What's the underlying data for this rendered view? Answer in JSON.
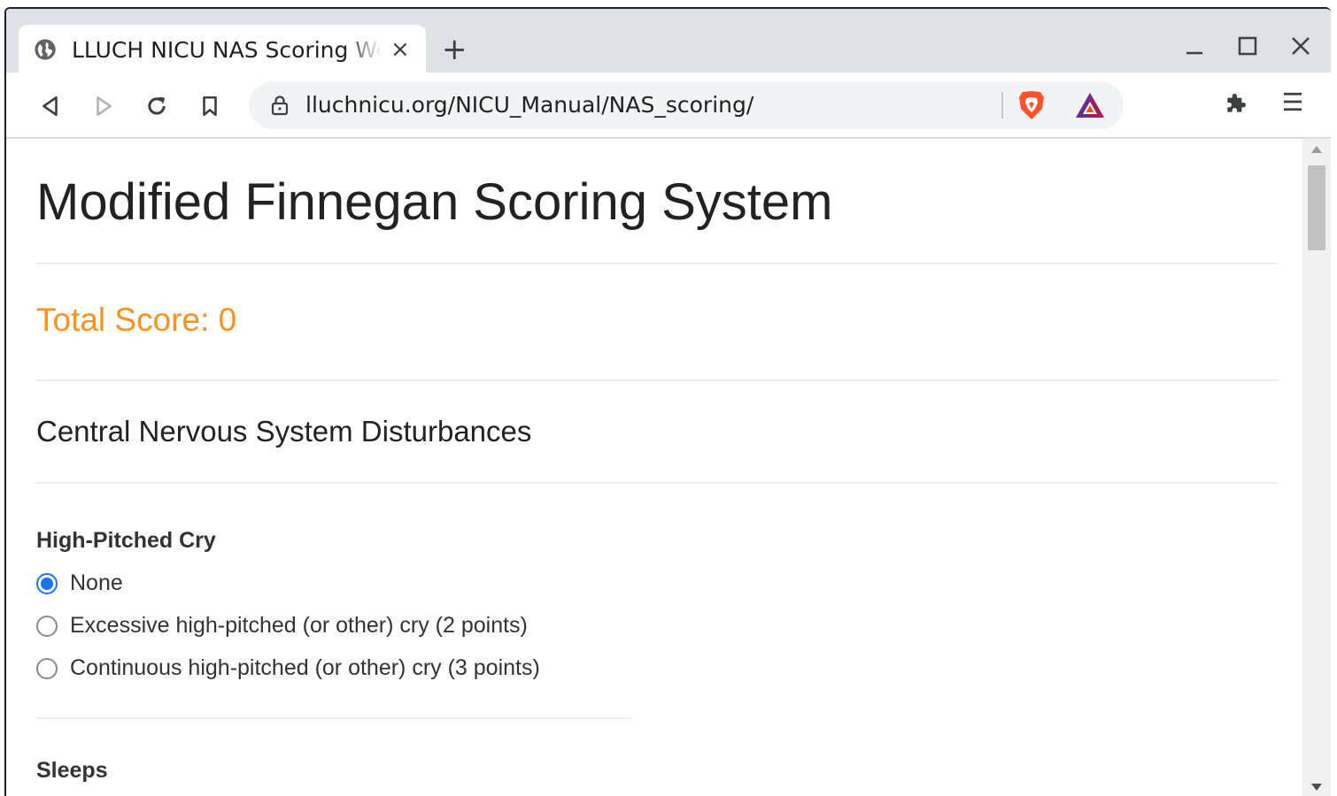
{
  "browser": {
    "tab_title": "LLUCH NICU NAS Scoring Web",
    "tab_close": "×",
    "new_tab": "+",
    "url": "lluchnicu.org/NICU_Manual/NAS_scoring/"
  },
  "icons": {
    "tab_favicon": "globe-icon",
    "back": "back-arrow-icon",
    "forward": "forward-arrow-icon",
    "reload": "reload-icon",
    "bookmark": "bookmark-icon",
    "lock": "lock-icon",
    "brave": "brave-shield-icon",
    "rewards": "bat-rewards-icon",
    "extensions": "puzzle-icon",
    "menu": "hamburger-menu-icon"
  },
  "colors": {
    "total_score": "#f7931e",
    "radio_checked": "#1a73e8",
    "brave": "#fb542b"
  },
  "page": {
    "title": "Modified Finnegan Scoring System",
    "total_score": "Total Score: 0",
    "section": "Central Nervous System Disturbances",
    "questions": [
      {
        "label": "High-Pitched Cry",
        "options": [
          {
            "label": "None",
            "checked": true
          },
          {
            "label": "Excessive high-pitched (or other) cry (2 points)",
            "checked": false
          },
          {
            "label": "Continuous high-pitched (or other) cry (3 points)",
            "checked": false
          }
        ]
      },
      {
        "label": "Sleeps",
        "options": []
      }
    ]
  }
}
